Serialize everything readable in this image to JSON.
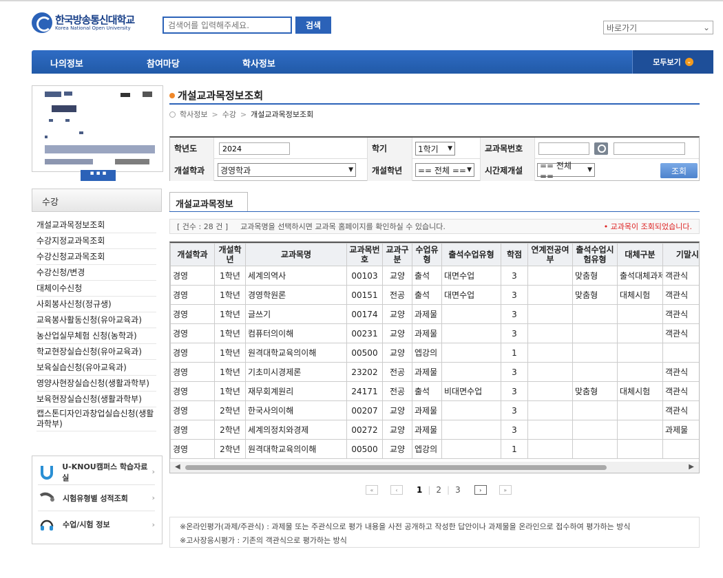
{
  "header": {
    "logo_ko": "한국방송통신대학교",
    "logo_en": "Korea National Open University",
    "search_placeholder": "검색어를 입력해주세요.",
    "search_button": "검색",
    "quick_select": "바로가기"
  },
  "gnb": {
    "items": [
      "나의정보",
      "참여마당",
      "학사정보"
    ],
    "view_all": "모두보기"
  },
  "sidebar": {
    "section_title": "수강",
    "items": [
      "개설교과목정보조회",
      "수강지정교과목조회",
      "수강신청교과목조회",
      "수강신청/변경",
      "대체이수신청",
      "사회봉사신청(정규생)",
      "교육봉사활동신청(유아교육과)",
      "농산업실무체험 신청(농학과)",
      "학교현장실습신청(유아교육과)",
      "보육실습신청(유아교육과)",
      "영양사현장실습신청(생활과학부)",
      "보육현장실습신청(생활과학부)",
      "캡스톤디자인과창업실습신청(생활과학부)"
    ],
    "quick_links": [
      "U-KNOU캠퍼스 학습자료실",
      "시험유형별 성적조회",
      "수업/시험 정보"
    ]
  },
  "main": {
    "title": "개설교과목정보조회",
    "breadcrumb": [
      "학사정보",
      "수강",
      "개설교과목정보조회"
    ],
    "filter": {
      "year_label": "학년도",
      "year_value": "2024",
      "semester_label": "학기",
      "semester_value": "1학기",
      "code_label": "교과목번호",
      "dept_label": "개설학과",
      "dept_value": "경영학과",
      "grade_label": "개설학년",
      "grade_value": "== 전체 ==",
      "time_label": "시간제개설",
      "time_value": "== 전체 ==",
      "search_button": "조회"
    },
    "tab": "개설교과목정보",
    "count_text": "[ 건수 : 28 건 ]",
    "info_text": "교과목명을 선택하시면 교과목 홈페이지를 확인하실 수 있습니다.",
    "status_text": "• 교과목이 조회되었습니다.",
    "table": {
      "headers": [
        "개설학과",
        "개설학년",
        "교과목명",
        "교과목번 호",
        "교과구분",
        "수업유형",
        "출석수업유형",
        "학점",
        "연계전공여 부",
        "출석수업시험유형",
        "대체구분",
        "기말시험유형"
      ],
      "rows": [
        [
          "경영",
          "1학년",
          "세계의역사",
          "00103",
          "교양",
          "출석",
          "대면수업",
          "3",
          "",
          "맞춤형",
          "출석대체과제",
          "객관식"
        ],
        [
          "경영",
          "1학년",
          "경영학원론",
          "00151",
          "전공",
          "출석",
          "대면수업",
          "3",
          "",
          "맞춤형",
          "대체시험",
          "객관식"
        ],
        [
          "경영",
          "1학년",
          "글쓰기",
          "00174",
          "교양",
          "과제물",
          "",
          "3",
          "",
          "",
          "",
          "객관식"
        ],
        [
          "경영",
          "1학년",
          "컴퓨터의이해",
          "00231",
          "교양",
          "과제물",
          "",
          "3",
          "",
          "",
          "",
          "객관식"
        ],
        [
          "경영",
          "1학년",
          "원격대학교육의이해",
          "00500",
          "교양",
          "엡강의",
          "",
          "1",
          "",
          "",
          "",
          ""
        ],
        [
          "경영",
          "1학년",
          "기초미시경제론",
          "23202",
          "전공",
          "과제물",
          "",
          "3",
          "",
          "",
          "",
          "객관식"
        ],
        [
          "경영",
          "1학년",
          "재무회계원리",
          "24171",
          "전공",
          "출석",
          "비대면수업",
          "3",
          "",
          "맞춤형",
          "대체시험",
          "객관식"
        ],
        [
          "경영",
          "2학년",
          "한국사의이해",
          "00207",
          "교양",
          "과제물",
          "",
          "3",
          "",
          "",
          "",
          "객관식"
        ],
        [
          "경영",
          "2학년",
          "세계의정치와경제",
          "00272",
          "교양",
          "과제물",
          "",
          "3",
          "",
          "",
          "",
          "과제물"
        ],
        [
          "경영",
          "2학년",
          "원격대학교육의이해",
          "00500",
          "교양",
          "엡강의",
          "",
          "1",
          "",
          "",
          "",
          ""
        ]
      ]
    },
    "pager": {
      "first": "«",
      "prev": "‹",
      "pages": [
        "1",
        "2",
        "3"
      ],
      "current": "1",
      "next": "›",
      "last": "»"
    },
    "notes": [
      "※온라인평가(과제/주관식) : 과제물 또는 주관식으로 평가 내용을 사전 공개하고 작성한 답안이나 과제물을 온라인으로 접수하여 평가하는 방식",
      "※고사장응시평가 : 기존의 객관식으로 평가하는 방식"
    ]
  },
  "colors": {
    "primary": "#2b62b8",
    "accent": "#f0882a"
  }
}
